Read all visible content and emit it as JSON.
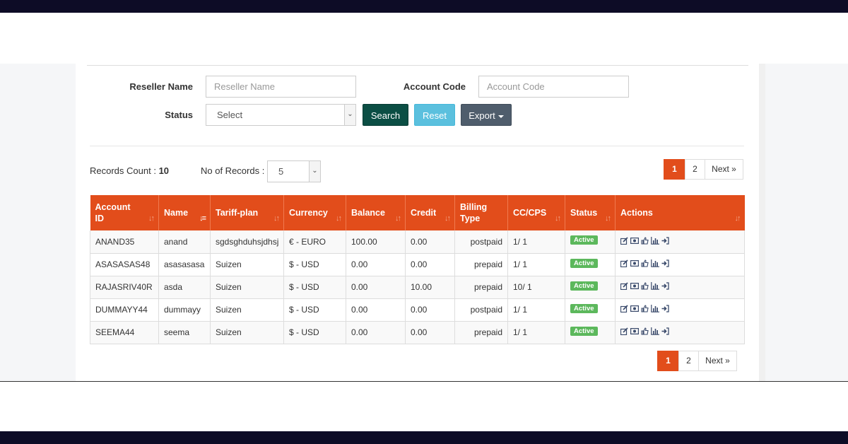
{
  "filters": {
    "reseller_label": "Reseller Name",
    "reseller_placeholder": "Reseller Name",
    "account_code_label": "Account Code",
    "account_code_placeholder": "Account Code",
    "status_label": "Status",
    "status_selected": "Select",
    "search_label": "Search",
    "reset_label": "Reset",
    "export_label": "Export"
  },
  "records": {
    "count_label": "Records Count :",
    "count_value": "10",
    "per_page_label": "No of Records :",
    "per_page_value": "5"
  },
  "pagination": {
    "pages": [
      "1",
      "2"
    ],
    "active": "1",
    "next_label": "Next »"
  },
  "table": {
    "columns": [
      "Account ID",
      "Name",
      "Tariff-plan",
      "Currency",
      "Balance",
      "Credit",
      "Billing Type",
      "CC/CPS",
      "Status",
      "Actions"
    ],
    "rows": [
      [
        "ANAND35",
        "anand",
        "sgdsghduhsjdhsj",
        "€ - EURO",
        "100.00",
        "0.00",
        "postpaid",
        "1/ 1",
        "Active"
      ],
      [
        "ASASASAS48",
        "asasasasa",
        "Suizen",
        "$ - USD",
        "0.00",
        "0.00",
        "prepaid",
        "1/ 1",
        "Active"
      ],
      [
        "RAJASRIV40R",
        "asda",
        "Suizen",
        "$ - USD",
        "0.00",
        "10.00",
        "prepaid",
        "10/ 1",
        "Active"
      ],
      [
        "DUMMAYY44",
        "dummayy",
        "Suizen",
        "$ - USD",
        "0.00",
        "0.00",
        "postpaid",
        "1/ 1",
        "Active"
      ],
      [
        "SEEMA44",
        "seema",
        "Suizen",
        "$ - USD",
        "0.00",
        "0.00",
        "prepaid",
        "1/ 1",
        "Active"
      ]
    ]
  },
  "icons": [
    "edit-icon",
    "money-icon",
    "thumbs-up-icon",
    "bar-chart-icon",
    "sign-in-icon"
  ],
  "colors": {
    "header_orange": "#e24d1b",
    "search_button": "#0b4e44",
    "reset_button": "#5bc0de",
    "export_button": "#4f5d6c",
    "active_badge": "#5cb85c",
    "frame_dark": "#0d0c26"
  }
}
